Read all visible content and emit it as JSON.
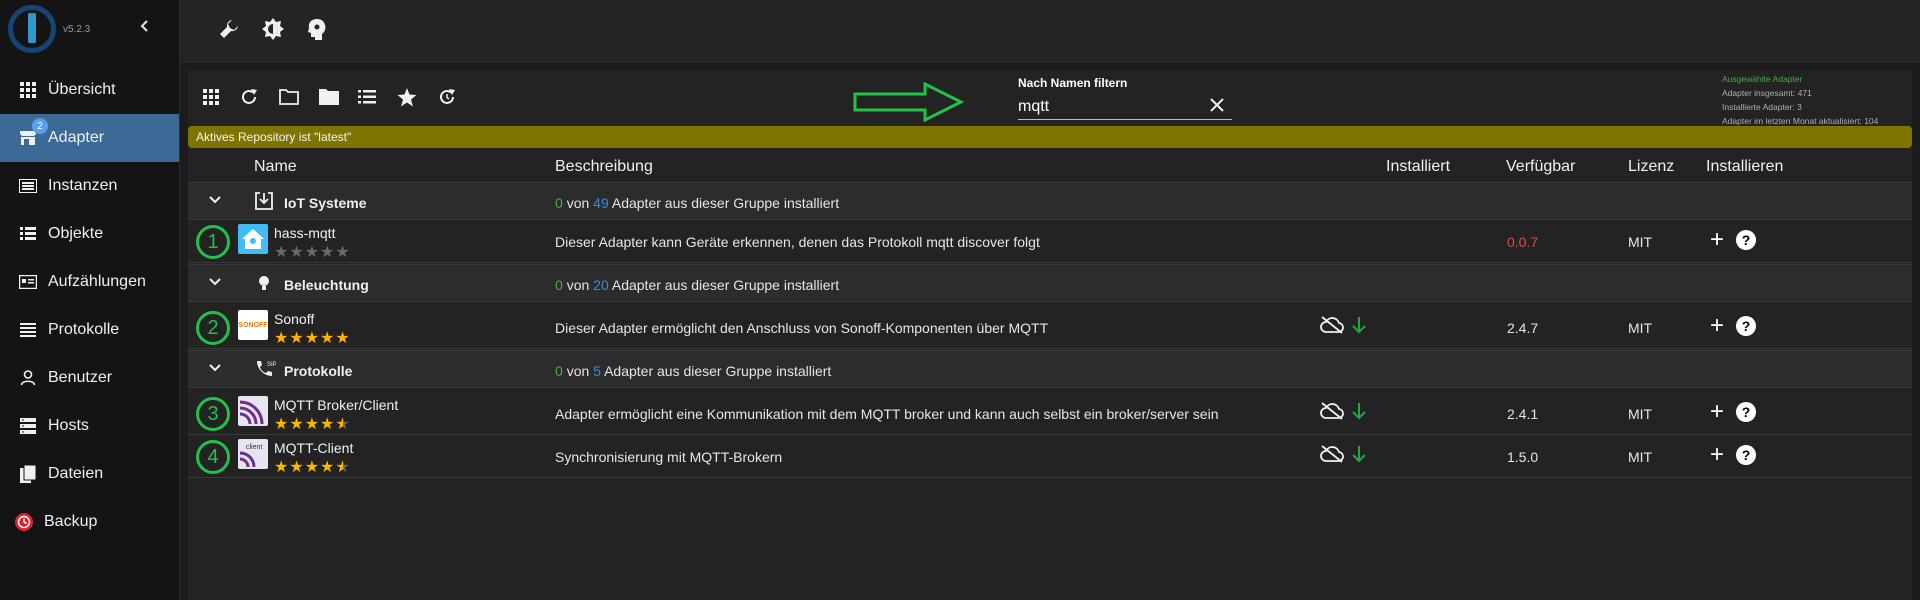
{
  "app": {
    "version": "v5.2.3"
  },
  "sidebar": {
    "items": [
      {
        "label": "Übersicht",
        "icon": "grid-icon"
      },
      {
        "label": "Adapter",
        "icon": "store-icon",
        "badge": "2",
        "active": true
      },
      {
        "label": "Instanzen",
        "icon": "instances-icon"
      },
      {
        "label": "Objekte",
        "icon": "list-icon"
      },
      {
        "label": "Aufzählungen",
        "icon": "enum-icon"
      },
      {
        "label": "Protokolle",
        "icon": "log-icon"
      },
      {
        "label": "Benutzer",
        "icon": "user-icon"
      },
      {
        "label": "Hosts",
        "icon": "hosts-icon"
      },
      {
        "label": "Dateien",
        "icon": "files-icon"
      },
      {
        "label": "Backup",
        "icon": "backup-icon"
      }
    ]
  },
  "topbar": {
    "buttons": [
      "wrench-icon",
      "brightness-icon",
      "expert-head-icon"
    ]
  },
  "toolbar": {
    "buttons": [
      "grid-view-icon",
      "refresh-icon",
      "folder-open-icon",
      "folder-icon",
      "list-icon",
      "star-icon",
      "update-icon"
    ],
    "filter_label": "Nach Namen filtern",
    "filter_value": "mqtt"
  },
  "stats": {
    "selected": "Ausgewählte Adapter",
    "total": "Adapter insgesamt: 471",
    "installed": "Installierte Adapter: 3",
    "updated": "Adapter im letzten Monat aktualisiert: 104"
  },
  "repo_notice": "Aktives Repository ist \"latest\"",
  "table": {
    "headers": {
      "name": "Name",
      "description": "Beschreibung",
      "installed": "Installiert",
      "available": "Verfügbar",
      "license": "Lizenz",
      "install": "Installieren"
    },
    "groups": [
      {
        "name": "IoT Systeme",
        "installed_count": "0",
        "of": "von",
        "total": "49",
        "suffix": "Adapter aus dieser Gruppe installiert",
        "adapters": [
          {
            "number": "1",
            "name": "hass-mqtt",
            "stars": 0,
            "description": "Dieser Adapter kann Geräte erkennen, denen das Protokoll mqtt discover folgt",
            "available": "0.0.7",
            "license": "MIT",
            "cloud_status": false
          }
        ]
      },
      {
        "name": "Beleuchtung",
        "installed_count": "0",
        "of": "von",
        "total": "20",
        "suffix": "Adapter aus dieser Gruppe installiert",
        "adapters": [
          {
            "number": "2",
            "name": "Sonoff",
            "stars": 5,
            "description": "Dieser Adapter ermöglicht den Anschluss von Sonoff-Komponenten über MQTT",
            "available": "2.4.7",
            "license": "MIT",
            "cloud_status": true
          }
        ]
      },
      {
        "name": "Protokolle",
        "installed_count": "0",
        "of": "von",
        "total": "5",
        "suffix": "Adapter aus dieser Gruppe installiert",
        "adapters": [
          {
            "number": "3",
            "name": "MQTT Broker/Client",
            "stars": 4.5,
            "description": "Adapter ermöglicht eine Kommunikation mit dem MQTT broker und kann auch selbst ein broker/server sein",
            "available": "2.4.1",
            "license": "MIT",
            "cloud_status": true
          },
          {
            "number": "4",
            "name": "MQTT-Client",
            "stars": 4.5,
            "description": "Synchronisierung mit MQTT-Brokern",
            "available": "1.5.0",
            "license": "MIT",
            "cloud_status": true
          }
        ]
      }
    ]
  },
  "colors": {
    "accent_nav": "#3c6a96",
    "repo_bar": "#807400",
    "annotation_green": "#22c24a",
    "star": "#ffb400",
    "version_red": "#e14b4b"
  }
}
